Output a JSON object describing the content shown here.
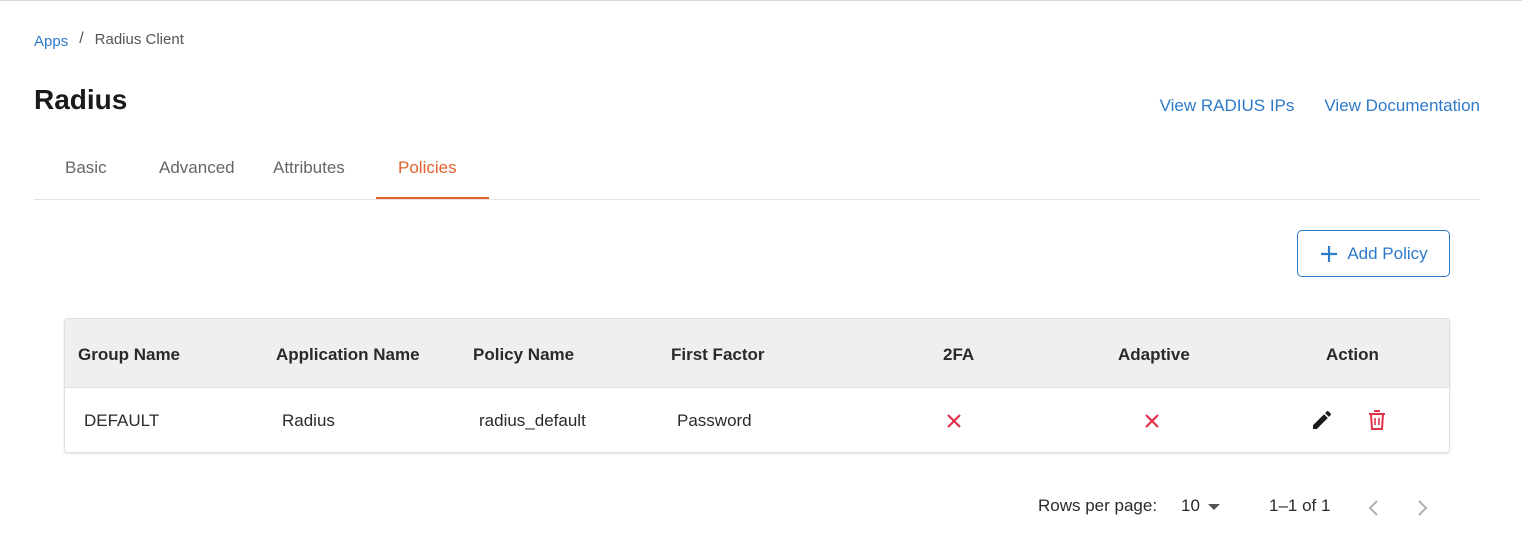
{
  "breadcrumb": {
    "root": "Apps",
    "separator": "/",
    "current": "Radius Client"
  },
  "page": {
    "title": "Radius"
  },
  "header_links": {
    "view_ips": "View RADIUS IPs",
    "view_docs": "View Documentation"
  },
  "tabs": [
    {
      "label": "Basic",
      "active": false
    },
    {
      "label": "Advanced",
      "active": false
    },
    {
      "label": "Attributes",
      "active": false
    },
    {
      "label": "Policies",
      "active": true
    }
  ],
  "toolbar": {
    "add_policy_label": "Add Policy"
  },
  "table": {
    "columns": [
      "Group Name",
      "Application Name",
      "Policy Name",
      "First Factor",
      "2FA",
      "Adaptive",
      "Action"
    ],
    "rows": [
      {
        "group_name": "DEFAULT",
        "application_name": "Radius",
        "policy_name": "radius_default",
        "first_factor": "Password",
        "two_fa": false,
        "adaptive": false
      }
    ]
  },
  "pagination": {
    "rows_per_page_label": "Rows per page:",
    "rows_per_page": "10",
    "range": "1–1 of 1"
  },
  "colors": {
    "accent": "#2d7ac9",
    "active_tab": "#e0622c",
    "danger": "#e0304a"
  },
  "icons": {
    "add": "plus-icon",
    "disabled": "close-icon",
    "edit": "pencil-icon",
    "delete": "trash-icon",
    "prev": "chevron-left-icon",
    "next": "chevron-right-icon",
    "dropdown": "caret-down-icon"
  }
}
